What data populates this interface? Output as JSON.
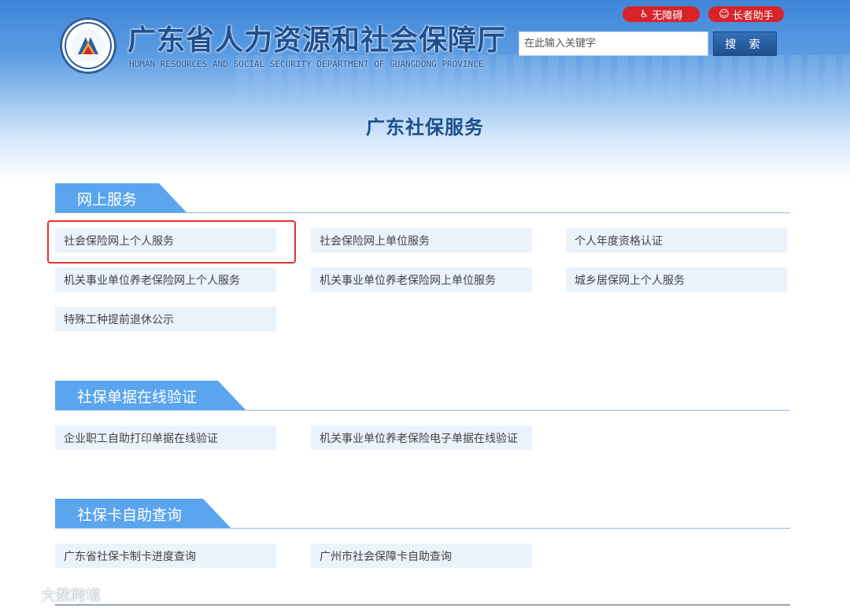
{
  "header": {
    "title": "广东省人力资源和社会保障厅",
    "subtitle": "HUMAN RESOURCES AND SOCIAL SECURITY DEPARTMENT OF GUANGDONG PROVINCE",
    "accessibility_label": "无障碍",
    "elderly_label": "长者助手",
    "search_placeholder": "在此输入关键字",
    "search_button_label": "搜 索",
    "accent_color": "#1f4f8f",
    "pill_color": "#d8232a"
  },
  "page_title": "广东社保服务",
  "sections": [
    {
      "title": "网上服务",
      "items": [
        "社会保险网上个人服务",
        "社会保险网上单位服务",
        "个人年度资格认证",
        "机关事业单位养老保险网上个人服务",
        "机关事业单位养老保险网上单位服务",
        "城乡居保网上个人服务",
        "特殊工种提前退休公示"
      ]
    },
    {
      "title": "社保单据在线验证",
      "items": [
        "企业职工自助打印单据在线验证",
        "机关事业单位养老保险电子单据在线验证"
      ]
    },
    {
      "title": "社保卡自助查询",
      "items": [
        "广东省社保卡制卡进度查询",
        "广州市社会保障卡自助查询"
      ]
    }
  ],
  "watermark": "大数跨境",
  "icons": {
    "accessibility": "wheelchair-icon",
    "elderly": "elderly-icon",
    "logo": "department-emblem"
  }
}
